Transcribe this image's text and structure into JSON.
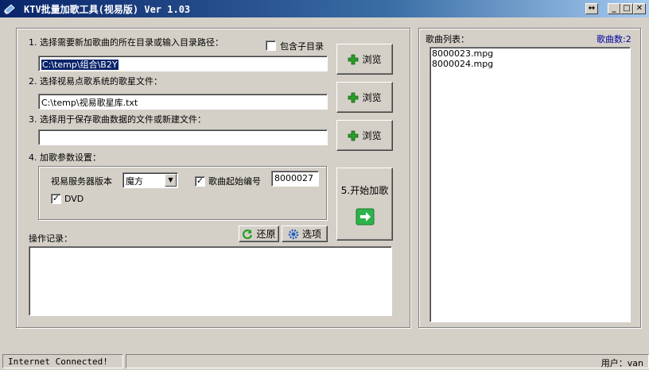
{
  "window": {
    "title": "KTV批量加歌工具(视易版) Ver 1.03",
    "restore_glyph": "↔",
    "minimize_glyph": "_",
    "maximize_glyph": "□",
    "close_glyph": "✕"
  },
  "step1": {
    "label": "1. 选择需要新加歌曲的所在目录或输入目录路径：",
    "include_subdirs_label": "包含子目录",
    "include_subdirs_checked": false,
    "path_value": "C:\\temp\\组合\\B2Y",
    "browse_label": "浏览"
  },
  "step2": {
    "label": "2. 选择视易点歌系统的歌星文件：",
    "path_value": "C:\\temp\\视易歌星库.txt",
    "browse_label": "浏览"
  },
  "step3": {
    "label": "3. 选择用于保存歌曲数据的文件或新建文件：",
    "path_value": "",
    "browse_label": "浏览"
  },
  "step4": {
    "label": "4. 加歌参数设置：",
    "server_version_label": "视易服务器版本",
    "server_version_value": "魔方",
    "start_number_checked": true,
    "start_number_label": "歌曲起始编号",
    "start_number_value": "8000027",
    "dvd_checked": true,
    "dvd_label": "DVD"
  },
  "step5": {
    "start_label": "5.开始加歌"
  },
  "log": {
    "label": "操作记录：",
    "restore_label": "还原",
    "options_label": "选项"
  },
  "song_list": {
    "label": "歌曲列表：",
    "count_label": "歌曲数:2",
    "items": [
      "8000023.mpg",
      "8000024.mpg"
    ]
  },
  "status": {
    "connection": "Internet Connected!",
    "user": "用户：van"
  },
  "colors": {
    "title_bar": "#0a246a",
    "count_label": "#0000a0",
    "selection": "#0a246a",
    "go_button": "#2db34a"
  }
}
